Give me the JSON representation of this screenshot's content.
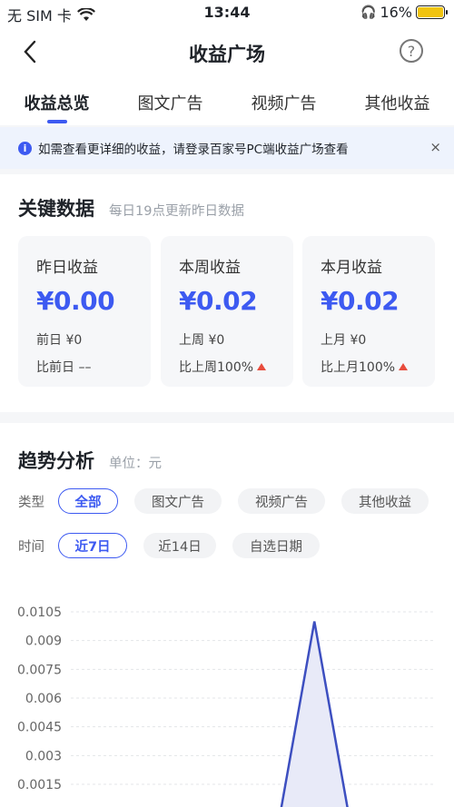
{
  "status_bar": {
    "carrier": "无 SIM 卡",
    "time": "13:44",
    "battery": "16%"
  },
  "nav": {
    "title": "收益广场",
    "help_glyph": "?"
  },
  "tabs": [
    {
      "label": "收益总览"
    },
    {
      "label": "图文广告"
    },
    {
      "label": "视频广告"
    },
    {
      "label": "其他收益"
    }
  ],
  "notice": {
    "text": "如需查看更详细的收益，请登录百家号PC端收益广场查看",
    "close": "×"
  },
  "key_data": {
    "title": "关键数据",
    "subtitle": "每日19点更新昨日数据",
    "cards": [
      {
        "label": "昨日收益",
        "value": "¥0.00",
        "prev": "前日 ¥0",
        "compare": "比前日 ––",
        "trend": ""
      },
      {
        "label": "本周收益",
        "value": "¥0.02",
        "prev": "上周 ¥0",
        "compare": "比上周100%",
        "trend": "up"
      },
      {
        "label": "本月收益",
        "value": "¥0.02",
        "prev": "上月 ¥0",
        "compare": "比上月100%",
        "trend": "up"
      }
    ]
  },
  "trend": {
    "title": "趋势分析",
    "unit": "单位：元",
    "type_label": "类型",
    "type_options": [
      "全部",
      "图文广告",
      "视频广告",
      "其他收益"
    ],
    "time_label": "时间",
    "time_options": [
      "近7日",
      "近14日",
      "自选日期"
    ]
  },
  "chart_data": {
    "type": "area",
    "y_ticks": [
      "0.0105",
      "0.009",
      "0.0075",
      "0.006",
      "0.0045",
      "0.003",
      "0.0015"
    ],
    "ylim": [
      0.0015,
      0.0105
    ],
    "series": [
      {
        "points": [
          [
            4.3,
            0.0
          ],
          [
            4.9,
            0.01
          ],
          [
            5.5,
            0.0
          ]
        ]
      }
    ],
    "grid": true,
    "line_color": "#3d4fc0",
    "fill_color": "#e8eaf8"
  }
}
